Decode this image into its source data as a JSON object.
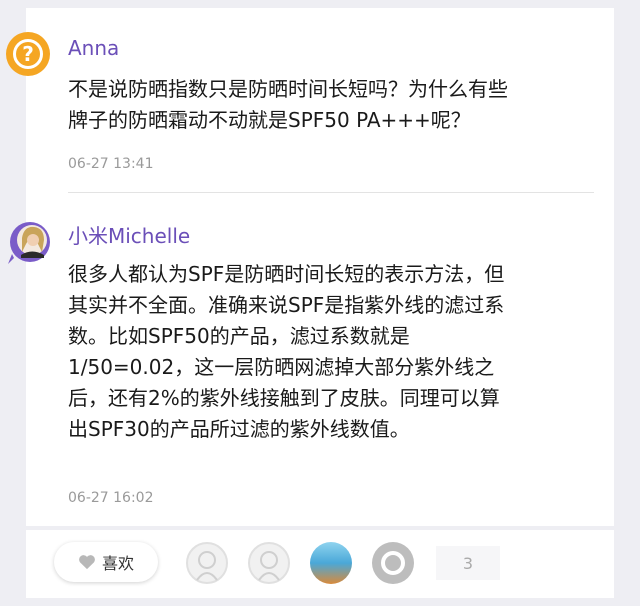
{
  "comments": [
    {
      "author": "Anna",
      "text_lines": [
        "不是说防晒指数只是防晒时间长短吗？为什么有些",
        "牌子的防晒霜动不动就是SPF50 PA+++呢？"
      ],
      "time": "06-27 13:41",
      "avatar_icon": "question-mark-icon"
    },
    {
      "author": "小米Michelle",
      "text_lines": [
        "很多人都认为SPF是防晒时间长短的表示方法，但",
        "其实并不全面。准确来说SPF是指紫外线的滤过系",
        "数。比如SPF50的产品，滤过系数就是",
        "1/50=0.02，这一层防晒网滤掉大部分紫外线之",
        "后，还有2%的紫外线接触到了皮肤。同理可以算",
        "出SPF30的产品所过滤的紫外线数值。"
      ],
      "time": "06-27 16:02",
      "avatar_icon": "user-photo-avatar"
    }
  ],
  "footer": {
    "like_label": "喜欢",
    "like_count": "3",
    "like_icon": "heart-icon"
  },
  "colors": {
    "accent": "#6b4fb8",
    "question_avatar": "#f5a623",
    "background": "#eeeef3"
  }
}
